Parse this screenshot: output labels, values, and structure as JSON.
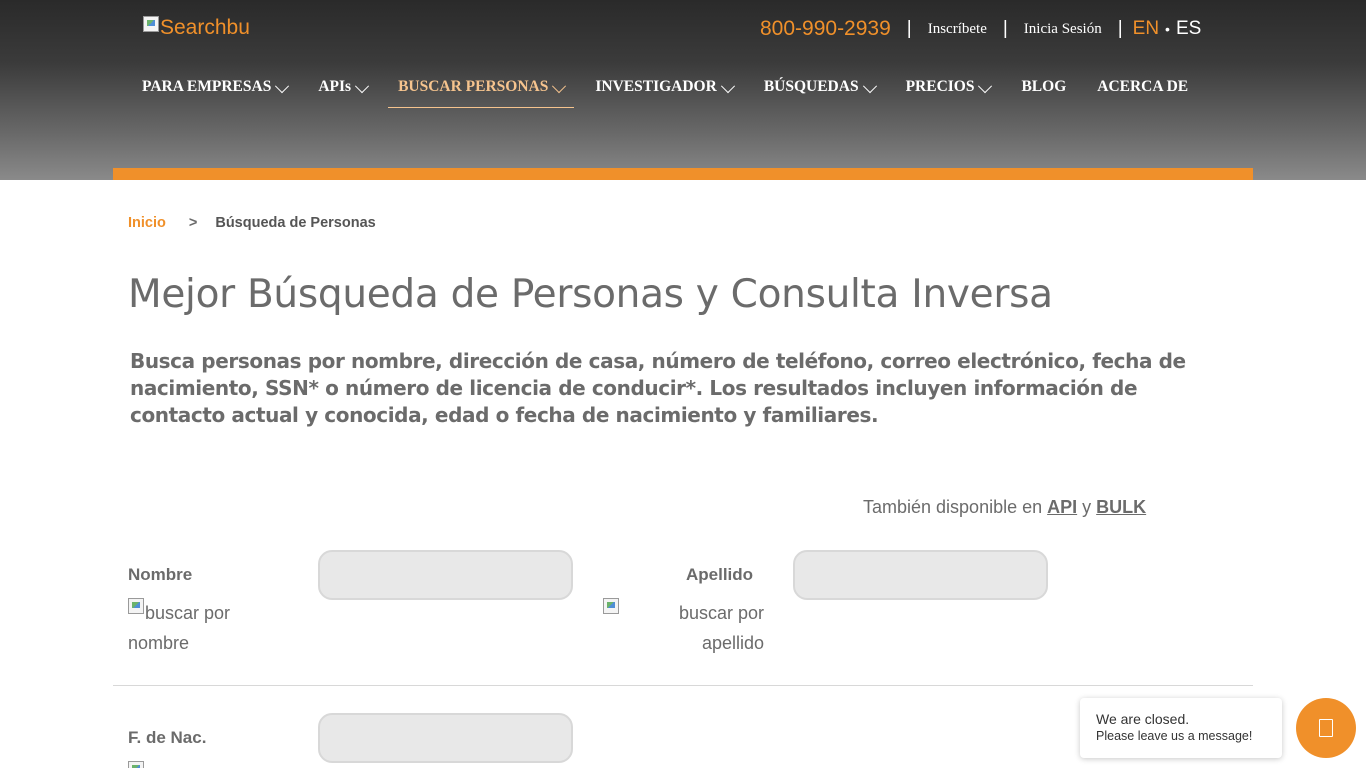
{
  "header": {
    "logo_text": "Searchbu",
    "phone": "800-990-2939",
    "sep": "|",
    "signup": "Inscríbete",
    "login": "Inicia Sesión",
    "lang_en": "EN",
    "lang_dot": "•",
    "lang_es": "ES"
  },
  "nav": {
    "items": [
      {
        "label": "PARA EMPRESAS"
      },
      {
        "label": "APIs"
      },
      {
        "label": "BUSCAR PERSONAS"
      },
      {
        "label": "INVESTIGADOR"
      },
      {
        "label": "BÚSQUEDAS"
      },
      {
        "label": "PRECIOS"
      },
      {
        "label": "BLOG"
      },
      {
        "label": "ACERCA DE"
      }
    ]
  },
  "breadcrumb": {
    "home": "Inicio",
    "sep": ">",
    "current": "Búsqueda de Personas"
  },
  "main": {
    "title": "Mejor Búsqueda de Personas y Consulta Inversa",
    "description": "Busca personas por nombre, dirección de casa, número de teléfono, correo electrónico, fecha de nacimiento, SSN* o número de licencia de conducir*. Los resultados incluyen información de contacto actual y conocida, edad o fecha de nacimiento y familiares.",
    "availability_prefix": "También disponible en ",
    "availability_api": "API",
    "availability_and": " y ",
    "availability_bulk": "BULK"
  },
  "form": {
    "first_name_label": "Nombre",
    "first_name_img_line1": "buscar por",
    "first_name_img_line2": "nombre",
    "last_name_label": "Apellido",
    "last_name_img_line1": "buscar por",
    "last_name_img_line2": "apellido",
    "dob_label": "F. de Nac."
  },
  "chat": {
    "line1": "We are closed.",
    "line2": "Please leave us a message!"
  },
  "colors": {
    "accent": "#f0902a",
    "text": "#6b6b6b",
    "nav_active": "#f6c48e"
  }
}
